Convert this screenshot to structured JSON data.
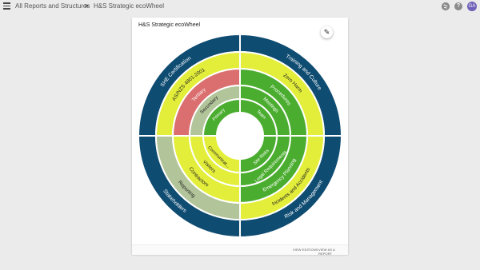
{
  "header": {
    "breadcrumb_root": "All Reports and Structures",
    "breadcrumb_separator": ">",
    "breadcrumb_current": "H&S Strategic ecoWheel",
    "globe_icon": "globe-icon",
    "help_icon": "help-icon",
    "help_glyph": "?",
    "avatar_initials": "GA"
  },
  "card": {
    "title": "H&S Strategic ecoWheel",
    "edit_icon": "pencil-icon",
    "footer": {
      "view_editions": "VIEW EDITIONS",
      "view_as_report": "VIEW AS A REPORT"
    }
  },
  "wheel": {
    "colors": {
      "navy": "#0f4c72",
      "lime": "#e3ee3a",
      "green": "#4aad2f",
      "red": "#db6e6e",
      "sage": "#b2c49a",
      "white": "#ffffff"
    },
    "outer": [
      {
        "label": "Training and Culture",
        "color": "navy"
      },
      {
        "label": "Risk and Management",
        "color": "navy"
      },
      {
        "label": "Stakeholders",
        "color": "navy"
      },
      {
        "label": "SHE Certification",
        "color": "navy"
      }
    ],
    "ring3": [
      {
        "label": "Zero Harm",
        "color": "lime"
      },
      {
        "label": "Incidents and Accidents",
        "color": "lime"
      },
      {
        "label": "Reporting",
        "color": "sage"
      },
      {
        "label": "AS/NZS 4801:2001",
        "color": "lime"
      }
    ],
    "ring2": [
      {
        "label": "Procedures",
        "color": "green"
      },
      {
        "label": "Emergency Planning",
        "color": "green"
      },
      {
        "label": "Contractors",
        "color": "lime"
      },
      {
        "label": "Tertiary",
        "color": "red"
      }
    ],
    "ring1": [
      {
        "label": "Meetings",
        "color": "green"
      },
      {
        "label": "Legal Requirements",
        "color": "green"
      },
      {
        "label": "Visitors",
        "color": "lime"
      },
      {
        "label": "Secondary",
        "color": "sage"
      }
    ],
    "ring0": [
      {
        "label": "Team",
        "color": "green"
      },
      {
        "label": "Site Risks",
        "color": "green"
      },
      {
        "label": "Communicat...",
        "color": "lime"
      },
      {
        "label": "Primary",
        "color": "green"
      }
    ]
  }
}
